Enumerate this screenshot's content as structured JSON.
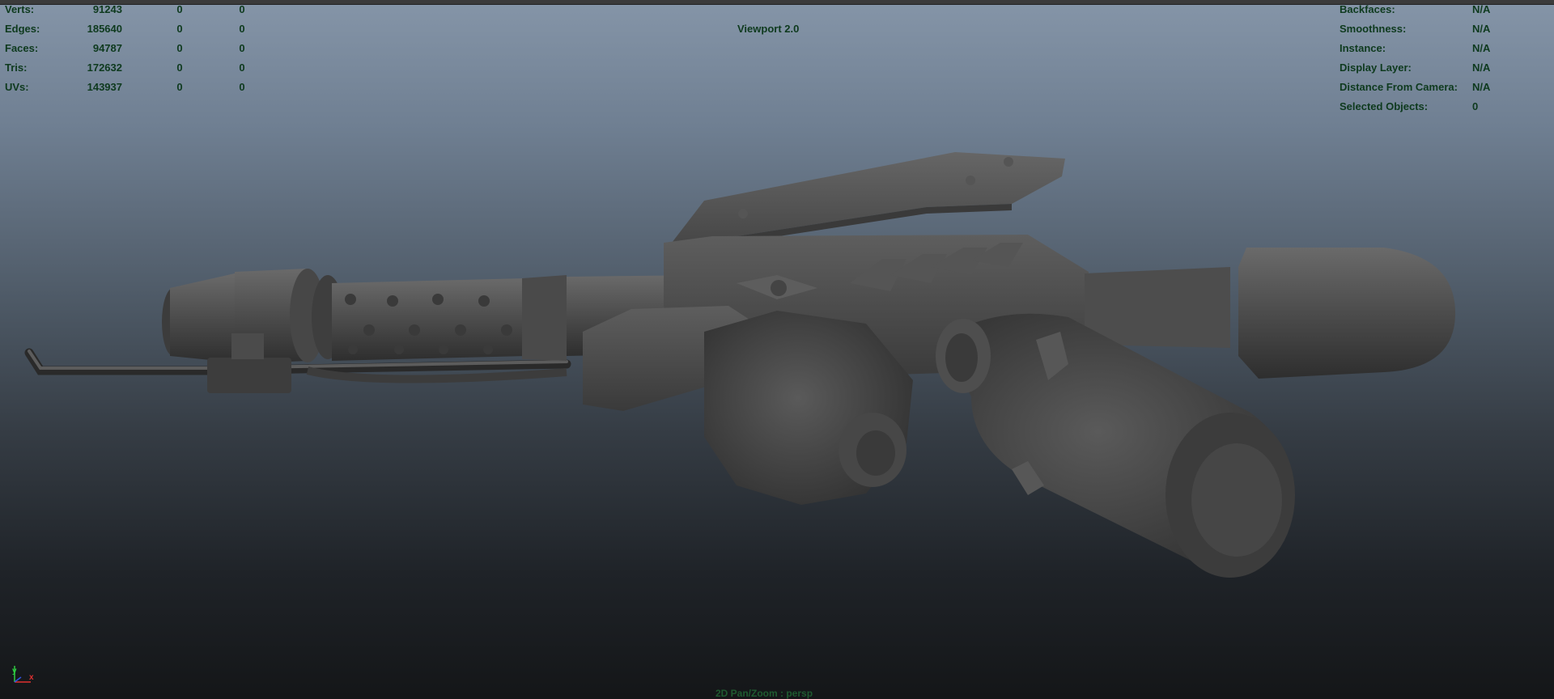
{
  "stats": {
    "rows": [
      {
        "label": "Verts:",
        "total": "91243",
        "selected": "0",
        "component": "0"
      },
      {
        "label": "Edges:",
        "total": "185640",
        "selected": "0",
        "component": "0"
      },
      {
        "label": "Faces:",
        "total": "94787",
        "selected": "0",
        "component": "0"
      },
      {
        "label": "Tris:",
        "total": "172632",
        "selected": "0",
        "component": "0"
      },
      {
        "label": "UVs:",
        "total": "143937",
        "selected": "0",
        "component": "0"
      }
    ]
  },
  "renderer": "Viewport 2.0",
  "info": {
    "rows": [
      {
        "label": "Backfaces:",
        "value": "N/A"
      },
      {
        "label": "Smoothness:",
        "value": "N/A"
      },
      {
        "label": "Instance:",
        "value": "N/A"
      },
      {
        "label": "Display Layer:",
        "value": "N/A"
      },
      {
        "label": "Distance From Camera:",
        "value": "N/A"
      },
      {
        "label": "Selected Objects:",
        "value": "0"
      }
    ]
  },
  "camera_label": "2D Pan/Zoom : persp",
  "axis": {
    "y_label": "y",
    "x_label": "x"
  },
  "colors": {
    "hud_text": "#0e3a1e",
    "model_fill": "#4a4a4a",
    "background_top": "#8595a8",
    "background_bottom": "#141618"
  }
}
